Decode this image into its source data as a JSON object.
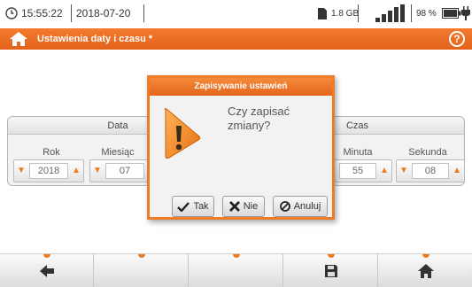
{
  "status_bar": {
    "time": "15:55:22",
    "date": "2018-07-20",
    "storage": "1.8 GB",
    "battery": "98 %",
    "clock_icon": "clock-icon",
    "sd_card_icon": "sd-card-icon",
    "signal_icon": "signal-bars-icon",
    "battery_icon": "battery-icon",
    "plug_icon": "power-plug-icon"
  },
  "title_bar": {
    "title": "Ustawienia daty i czasu *",
    "home_icon": "home-icon",
    "help_label": "?"
  },
  "date_panel": {
    "heading": "Data",
    "fields": [
      {
        "label": "Rok",
        "value": "2018"
      },
      {
        "label": "Miesiąc",
        "value": "07"
      }
    ]
  },
  "time_panel": {
    "heading": "Czas",
    "fields": [
      {
        "label": "Minuta",
        "value": "55"
      },
      {
        "label": "Sekunda",
        "value": "08"
      }
    ]
  },
  "dialog": {
    "title": "Zapisywanie ustawień",
    "message_line1": "Czy zapisać",
    "message_line2": "zmiany?",
    "buttons": [
      {
        "label": "Tak",
        "icon": "checkmark-icon"
      },
      {
        "label": "Nie",
        "icon": "cross-icon"
      },
      {
        "label": "Anuluj",
        "icon": "cancel-circle-icon"
      }
    ]
  },
  "bottom_bar": {
    "buttons": [
      "back-arrow-icon",
      "empty",
      "empty",
      "save-disk-icon",
      "home-icon"
    ]
  },
  "colors": {
    "accent": "#ef7a2a",
    "header_orange": "#e4651b"
  }
}
